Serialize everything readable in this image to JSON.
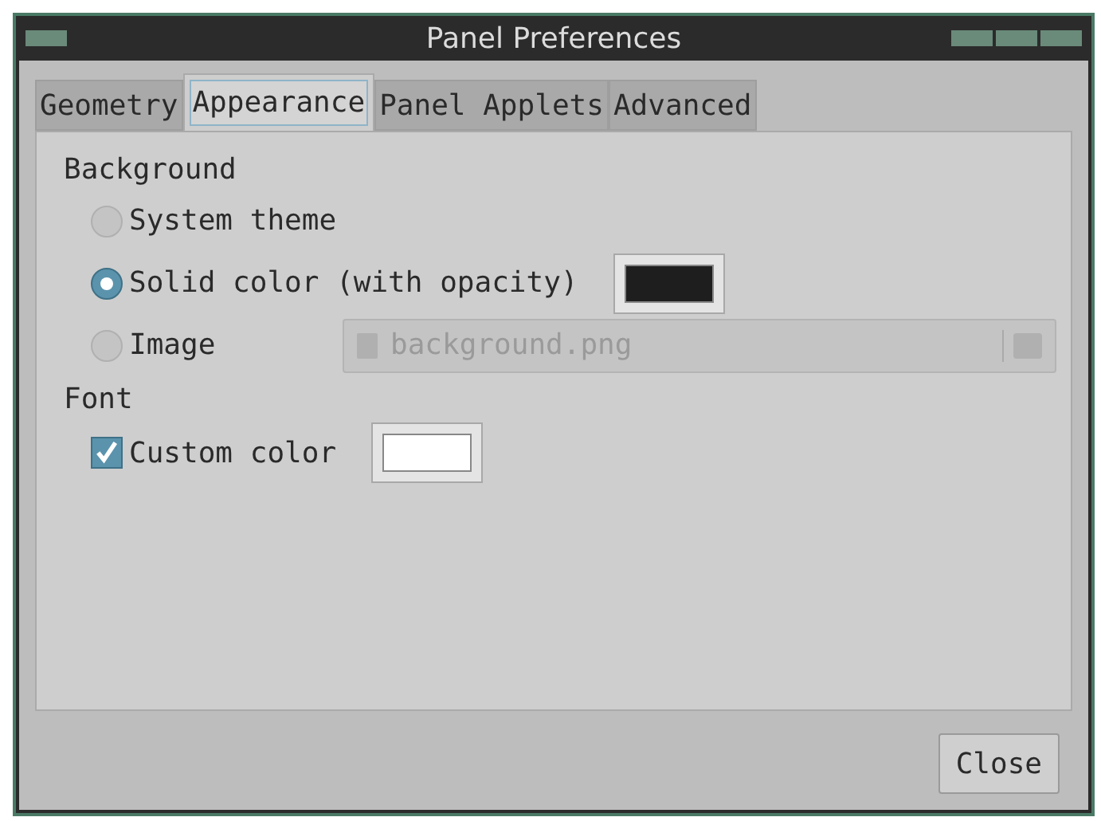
{
  "window": {
    "title": "Panel Preferences"
  },
  "tabs": [
    {
      "label": "Geometry",
      "selected": false
    },
    {
      "label": "Appearance",
      "selected": true
    },
    {
      "label": "Panel Applets",
      "selected": false
    },
    {
      "label": "Advanced",
      "selected": false
    }
  ],
  "background": {
    "heading": "Background",
    "options": [
      {
        "kind": "plain",
        "label": "System theme",
        "selected": false
      },
      {
        "kind": "color",
        "label": "Solid color (with opacity)",
        "selected": true,
        "color": "#1e1e1e"
      },
      {
        "kind": "file",
        "label": "Image",
        "selected": false,
        "file": "background.png",
        "disabled": true
      }
    ]
  },
  "font": {
    "heading": "Font",
    "custom_color": {
      "label": "Custom color",
      "checked": true,
      "color": "#ffffff"
    }
  },
  "buttons": [
    "Close"
  ]
}
